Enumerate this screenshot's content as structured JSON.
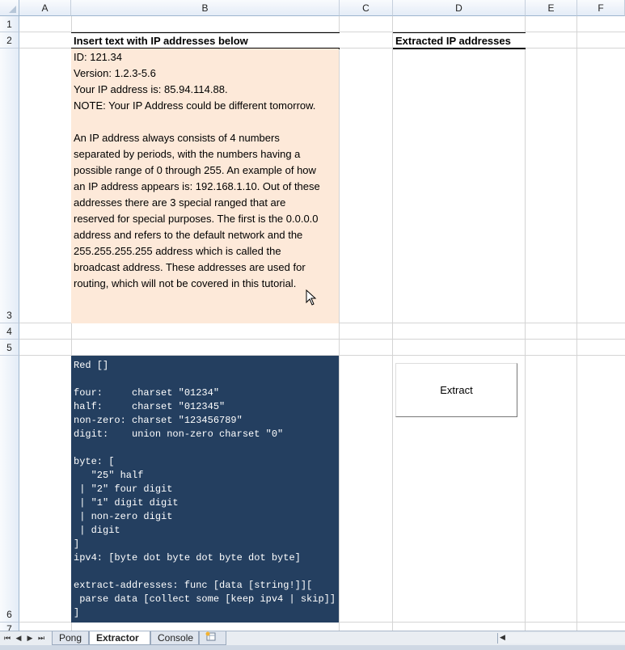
{
  "columns": [
    "A",
    "B",
    "C",
    "D",
    "E",
    "F"
  ],
  "rows": [
    "1",
    "2",
    "3",
    "4",
    "5",
    "6",
    "7"
  ],
  "cells": {
    "b2_title": "Insert text with IP addresses below",
    "d2_title": "Extracted IP addresses"
  },
  "input_text_lines": [
    "ID: 121.34",
    "Version: 1.2.3-5.6",
    "Your IP address is: 85.94.114.88.",
    "NOTE: Your IP Address could be different tomorrow.",
    "",
    "An IP address always consists of 4 numbers",
    "separated by periods, with the numbers having a",
    "possible range of 0 through 255. An example of how",
    "an IP address appears is: 192.168.1.10. Out of these",
    "addresses there are 3 special ranged that are",
    "reserved for special purposes. The first is the 0.0.0.0",
    "address and refers to the default network and the",
    "255.255.255.255 address which is called the",
    "broadcast address. These addresses are used for",
    "routing, which will not be covered in this tutorial."
  ],
  "code_lines": [
    "Red []",
    "",
    "four:     charset \"01234\"",
    "half:     charset \"012345\"",
    "non-zero: charset \"123456789\"",
    "digit:    union non-zero charset \"0\"",
    "",
    "byte: [",
    "   \"25\" half",
    " | \"2\" four digit",
    " | \"1\" digit digit",
    " | non-zero digit",
    " | digit",
    "]",
    "ipv4: [byte dot byte dot byte dot byte]",
    "",
    "extract-addresses: func [data [string!]][",
    " parse data [collect some [keep ipv4 | skip]]",
    "]"
  ],
  "button": {
    "label": "Extract"
  },
  "tabs": [
    {
      "label": "Pong",
      "active": false
    },
    {
      "label": "Extractor",
      "active": true
    },
    {
      "label": "Console",
      "active": false
    }
  ],
  "colors": {
    "input_fill": "#fde9d9",
    "code_fill": "#243f60",
    "code_text": "#ffffff"
  }
}
